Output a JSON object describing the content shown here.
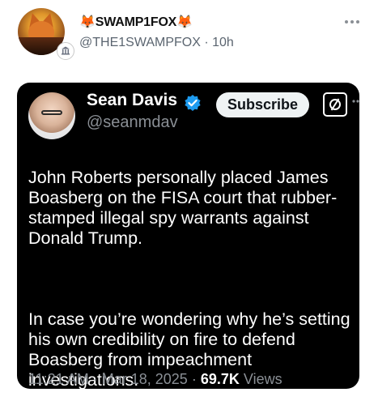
{
  "post": {
    "author_name": "🦊SWAMP1FOX🦊",
    "author_handle": "@THE1SWAMPFOX",
    "time_ago": "10h",
    "more_icon": "more-horizontal-icon"
  },
  "embedded": {
    "name": "Sean Davis",
    "handle": "@seanmdav",
    "subscribe_label": "Subscribe",
    "paragraphs": [
      "John Roberts personally placed James Boasberg on the FISA court that rubber-stamped illegal spy warrants against Donald Trump.",
      "In case you’re wondering why he’s setting his own credibility on fire to defend Boasberg from impeachment investigations."
    ],
    "time": "11:21 AM",
    "date": "Mar 18, 2025",
    "views_count": "69.7K",
    "views_label": "Views",
    "separator": "·"
  },
  "colors": {
    "verified_blue": "#1d9bf0",
    "card_bg": "#000000",
    "muted": "#8a8f95"
  }
}
